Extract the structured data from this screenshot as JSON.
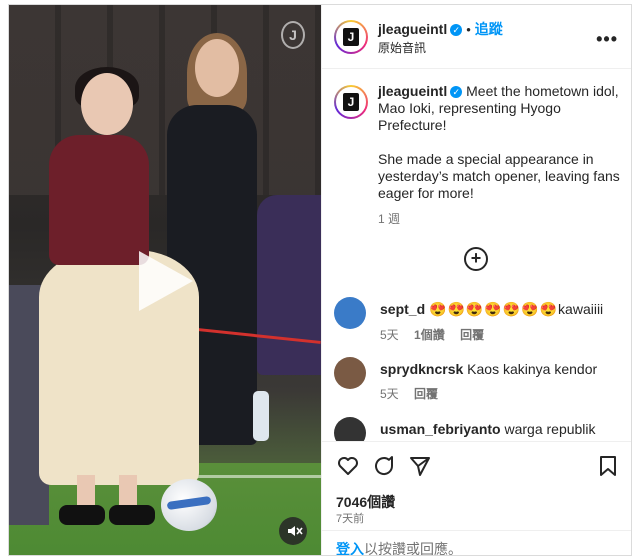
{
  "post": {
    "username": "jleagueintl",
    "follow_label": "追蹤",
    "subline": "原始音訊",
    "more_icon": "more-options-icon",
    "caption": "Meet the hometown idol, Mao Ioki, representing Hyogo Prefecture!\n\nShe made a special appearance in yesterday’s match opener, leaving fans eager for more!",
    "caption_time": "1 週"
  },
  "comments": [
    {
      "user": "sept_d",
      "emojis": "😍😍😍😍😍😍😍",
      "text": "kawaiiii",
      "time": "5天",
      "likes": "1個讚",
      "reply": "回覆",
      "avatar_color": "#3a7bc8"
    },
    {
      "user": "sprydkncrsk",
      "text": "Kaos kakinya kendor",
      "time": "5天",
      "reply": "回覆",
      "avatar_color": "#7a5a44"
    },
    {
      "user": "usman_febriyanto",
      "text": "warga republik",
      "avatar_color": "#333333"
    }
  ],
  "stats": {
    "views": "7046個讚",
    "date": "7天前"
  },
  "login": {
    "link": "登入",
    "rest": "以按讚或回應。"
  },
  "colors": {
    "accent": "#0095f6",
    "text": "#262626",
    "muted": "#737373"
  }
}
